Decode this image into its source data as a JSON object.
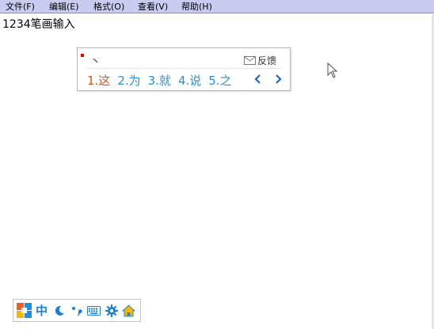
{
  "menubar": {
    "items": [
      {
        "label": "文件(F)"
      },
      {
        "label": "编辑(E)"
      },
      {
        "label": "格式(O)"
      },
      {
        "label": "查看(V)"
      },
      {
        "label": "帮助(H)"
      }
    ]
  },
  "document": {
    "text": "1234笔画输入"
  },
  "ime": {
    "composition": "丶",
    "feedback_label": "反馈",
    "candidates": [
      {
        "label": "1.这"
      },
      {
        "label": "2.为"
      },
      {
        "label": "3.就"
      },
      {
        "label": "4.说"
      },
      {
        "label": "5.之"
      }
    ],
    "colors": {
      "first_candidate": "#d2541b",
      "candidate": "#2c8fd6",
      "accent": "#1a7fd6"
    }
  },
  "status_bar": {
    "mode_label": "中",
    "icons": [
      "ime-logo-icon",
      "chinese-mode",
      "moon-icon",
      "punctuation-icon",
      "keyboard-icon",
      "gear-icon",
      "home-icon"
    ]
  }
}
